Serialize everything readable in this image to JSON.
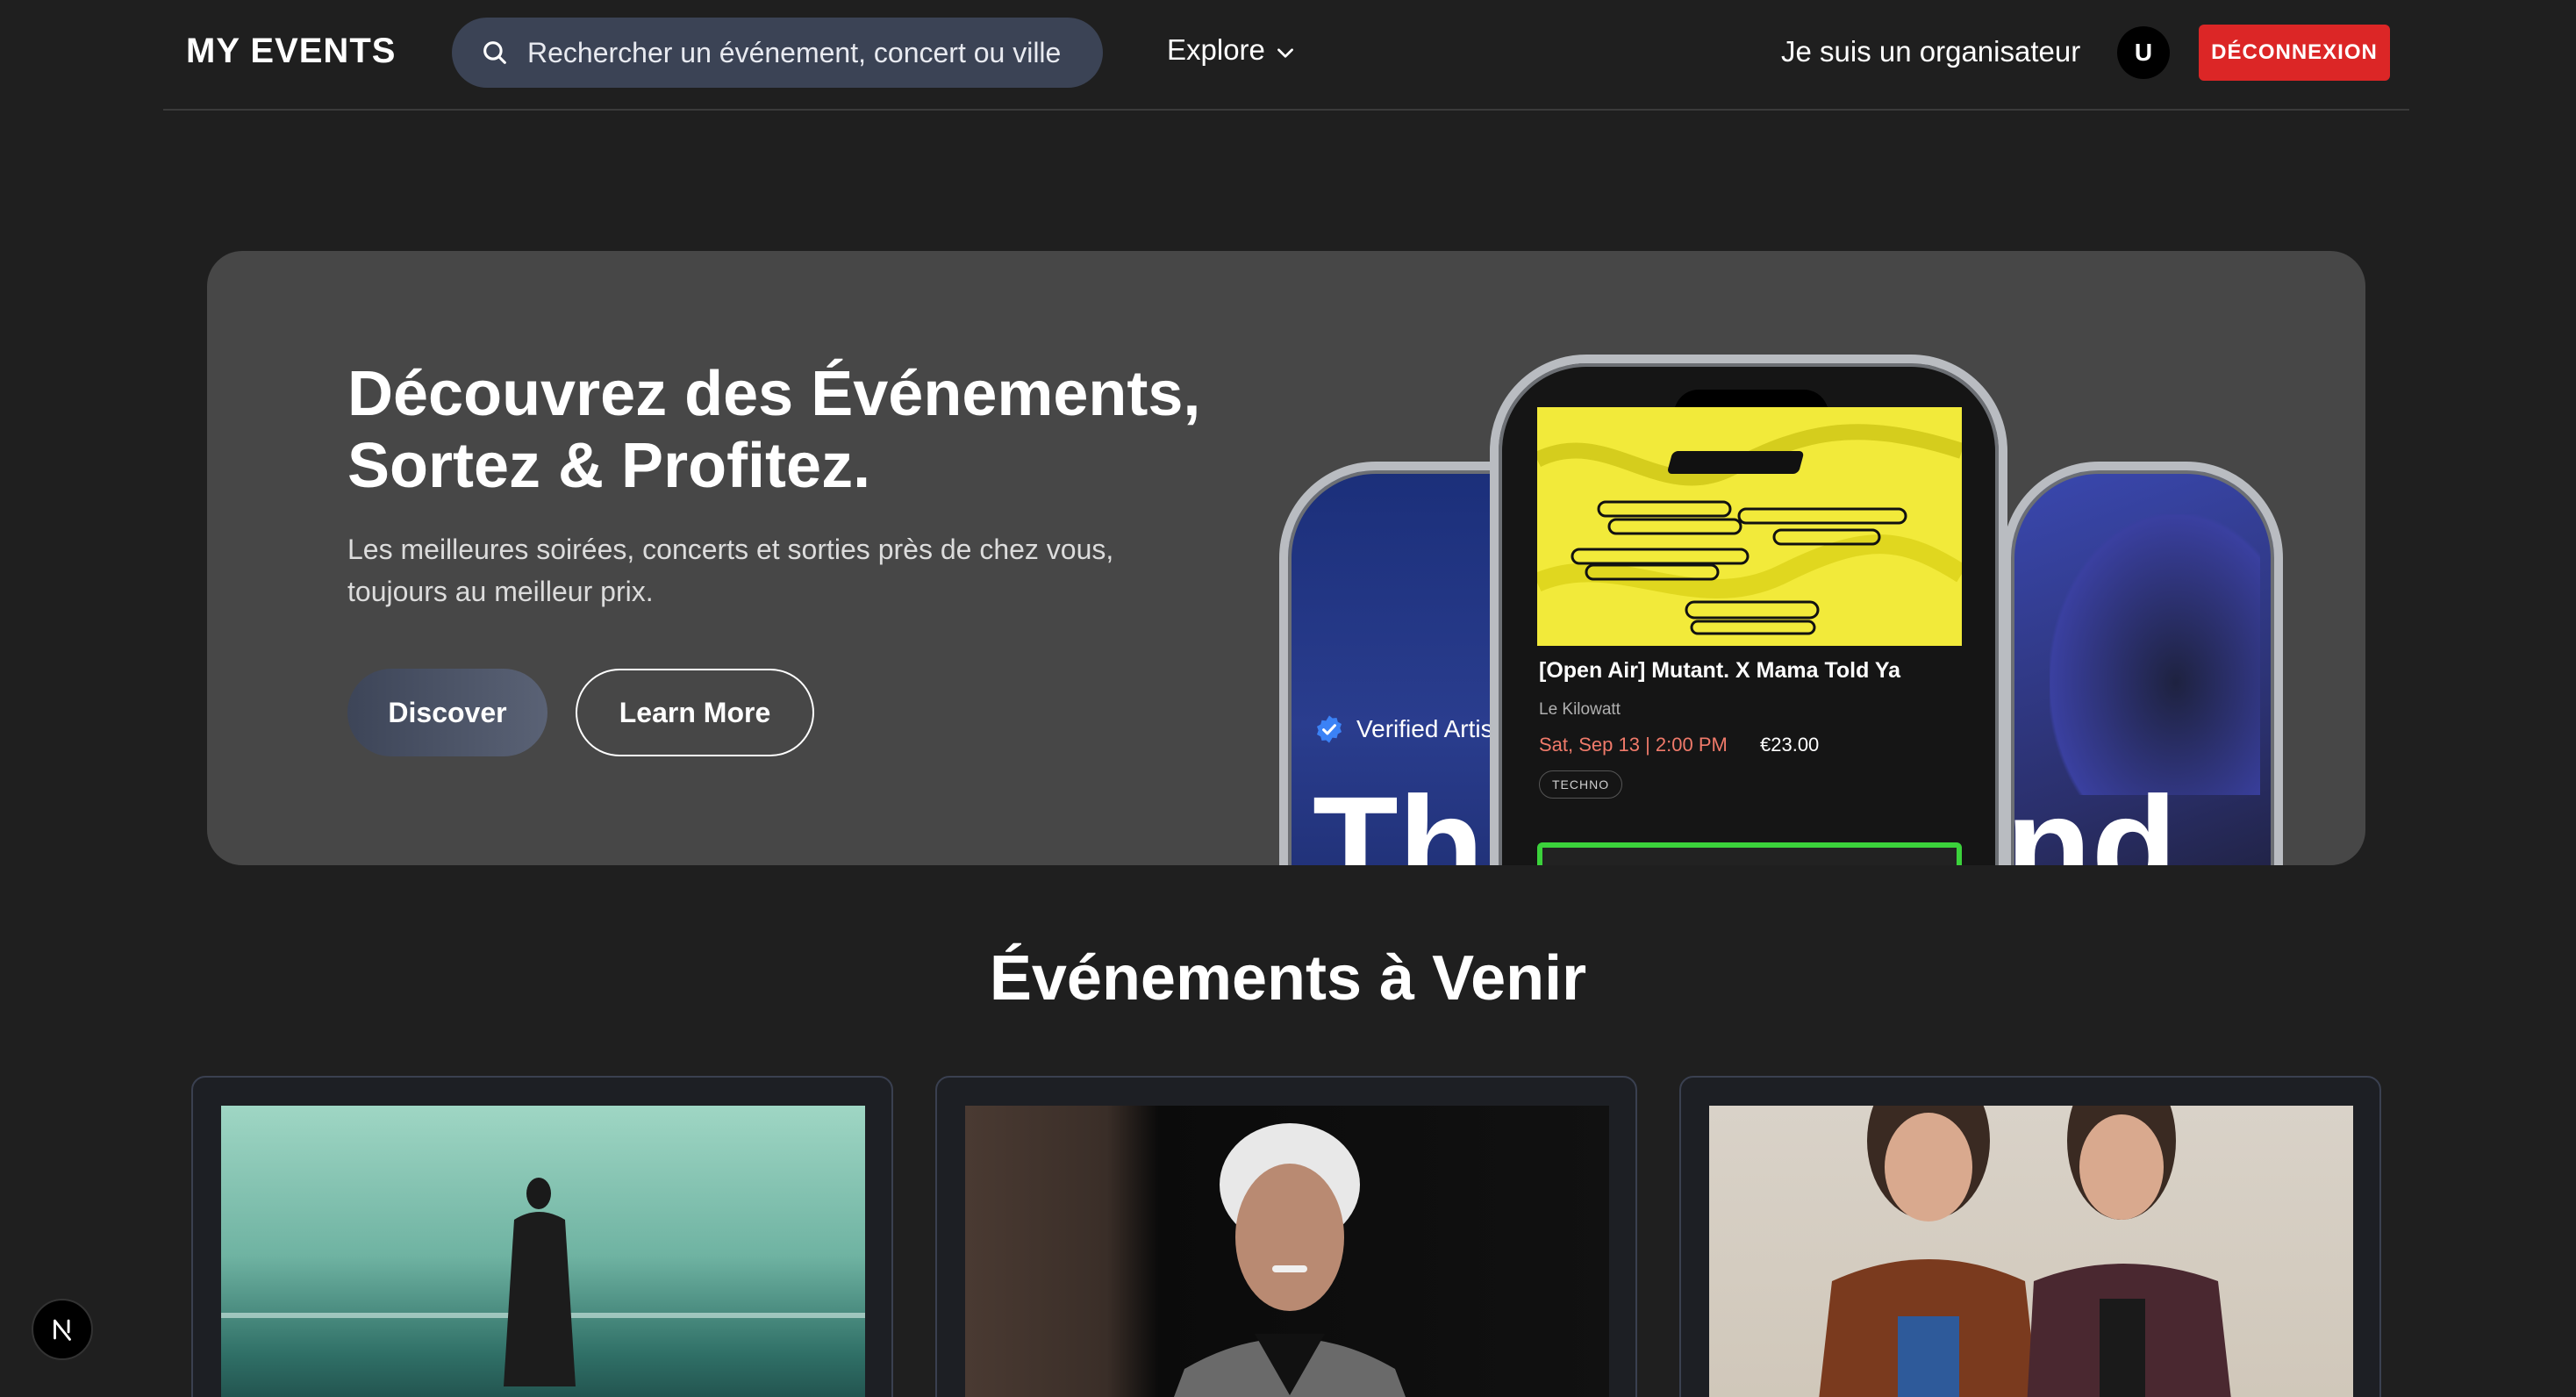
{
  "header": {
    "logo": "MY EVENTS",
    "search_placeholder": "Rechercher un événement, concert ou ville",
    "explore_label": "Explore",
    "organizer_label": "Je suis un organisateur",
    "avatar_initial": "U",
    "logout_label": "DÉCONNEXION"
  },
  "hero": {
    "title_line1": "Découvrez des Événements,",
    "title_line2": "Sortez & Profitez.",
    "subtitle_line1": "Les meilleures soirées, concerts et sorties près de chez vous,",
    "subtitle_line2": "toujours au meilleur prix.",
    "discover_label": "Discover",
    "learn_more_label": "Learn More",
    "phone_left": {
      "verified_label": "Verified Artis",
      "big_text": "Th"
    },
    "phone_right": {
      "big_text": "nd"
    },
    "phone_center": {
      "event_title": "[Open Air] Mutant. X Mama Told Ya",
      "venue": "Le Kilowatt",
      "date": "Sat, Sep 13 | 2:00 PM",
      "price": "€23.00",
      "tag": "TECHNO"
    }
  },
  "section": {
    "title": "Événements à Venir"
  },
  "colors": {
    "background": "#1f1f1f",
    "hero_bg": "#474747",
    "search_bg": "#3b4355",
    "logout": "#dc2626",
    "date_accent": "#f07a6a",
    "ticket_border": "#3bd23b"
  },
  "icons": {
    "search": "search-icon",
    "explore_chevron": "chevron-down-icon",
    "verified": "verified-badge-icon",
    "nextjs": "nextjs-icon"
  }
}
